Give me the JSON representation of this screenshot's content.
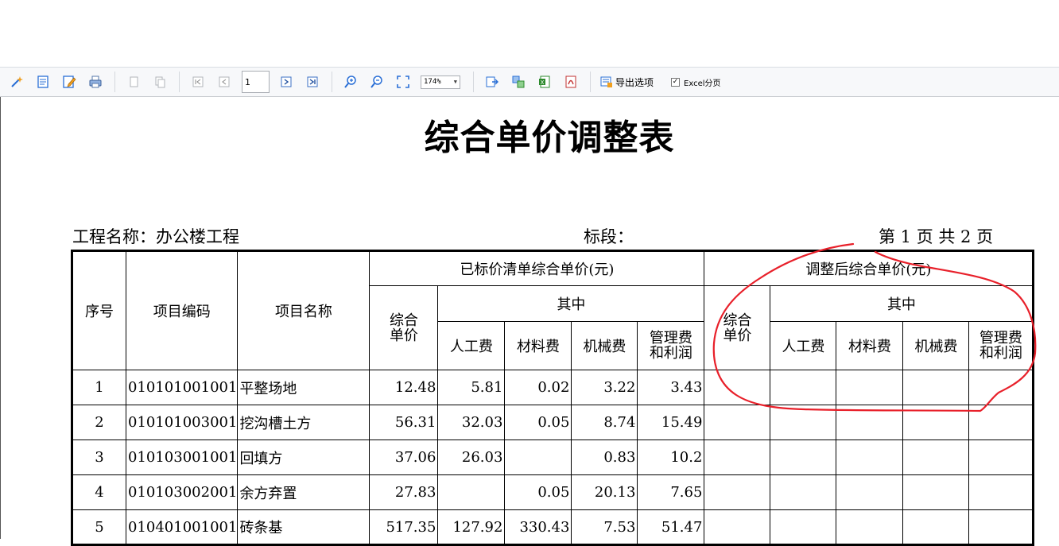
{
  "toolbar": {
    "buttons": [
      {
        "name": "design-tool",
        "icon": "wand-icon"
      },
      {
        "name": "page-setup",
        "icon": "page-icon"
      },
      {
        "name": "edit",
        "icon": "edit-icon"
      },
      {
        "name": "print",
        "icon": "printer-icon"
      },
      {
        "name": "copy",
        "icon": "copy-icon"
      },
      {
        "name": "paste",
        "icon": "paste-icon"
      },
      {
        "name": "first-page",
        "icon": "first-page-icon"
      },
      {
        "name": "prev-page",
        "icon": "prev-page-icon"
      },
      {
        "name": "next-page",
        "icon": "next-page-icon"
      },
      {
        "name": "last-page",
        "icon": "last-page-icon"
      },
      {
        "name": "zoom-in",
        "icon": "zoom-in-icon"
      },
      {
        "name": "zoom-out",
        "icon": "zoom-out-icon"
      },
      {
        "name": "fit-page",
        "icon": "fit-icon"
      },
      {
        "name": "export-1",
        "icon": "export-icon"
      },
      {
        "name": "export-2",
        "icon": "export-icon"
      },
      {
        "name": "export-excel",
        "icon": "excel-icon"
      },
      {
        "name": "export-pdf",
        "icon": "pdf-icon"
      }
    ],
    "page_number": "1",
    "zoom": "174%",
    "export_options_label": "导出选项",
    "excel_paging_label": "Excel分页",
    "excel_paging_checked": true
  },
  "document": {
    "title": "综合单价调整表",
    "project_label": "工程名称：办公楼工程",
    "section_label": "标段：",
    "page_info": "第 1 页   共 2 页"
  },
  "table": {
    "headers": {
      "seq": "序号",
      "code": "项目编码",
      "name": "项目名称",
      "bid_group": "已标价清单综合单价(元)",
      "adj_group": "调整后综合单价(元)",
      "unit_price_line1": "综合",
      "unit_price_line2": "单价",
      "among": "其中",
      "labor": "人工费",
      "material": "材料费",
      "machine": "机械费",
      "mgmt_line1": "管理费",
      "mgmt_line2": "和利润"
    },
    "rows": [
      {
        "seq": "1",
        "code": "010101001001",
        "name": "平整场地",
        "price": "12.48",
        "labor": "5.81",
        "material": "0.02",
        "machine": "3.22",
        "mgmt": "3.43"
      },
      {
        "seq": "2",
        "code": "010101003001",
        "name": "挖沟槽土方",
        "price": "56.31",
        "labor": "32.03",
        "material": "0.05",
        "machine": "8.74",
        "mgmt": "15.49"
      },
      {
        "seq": "3",
        "code": "010103001001",
        "name": "回填方",
        "price": "37.06",
        "labor": "26.03",
        "material": "",
        "machine": "0.83",
        "mgmt": "10.2"
      },
      {
        "seq": "4",
        "code": "010103002001",
        "name": "余方弃置",
        "price": "27.83",
        "labor": "",
        "material": "0.05",
        "machine": "20.13",
        "mgmt": "7.65"
      },
      {
        "seq": "5",
        "code": "010401001001",
        "name": "砖条基",
        "price": "517.35",
        "labor": "127.92",
        "material": "330.43",
        "machine": "7.53",
        "mgmt": "51.47"
      }
    ]
  },
  "colors": {
    "annotation": "#e8202a"
  }
}
